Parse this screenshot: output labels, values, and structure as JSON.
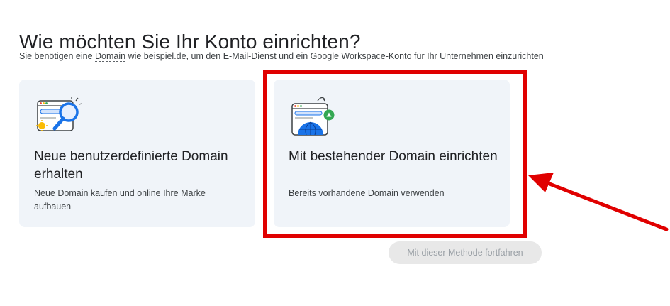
{
  "header": {
    "title": "Wie möchten Sie Ihr Konto einrichten?",
    "subtitle_prefix": "Sie benötigen eine ",
    "subtitle_link": "Domain",
    "subtitle_suffix": " wie beispiel.de, um den E-Mail-Dienst und ein Google Workspace-Konto für Ihr Unternehmen einzurichten"
  },
  "options": [
    {
      "title": "Neue benutzerdefinierte Domain erhalten",
      "description": "Neue Domain kaufen und online Ihre Marke aufbauen",
      "icon": "domain-search-icon"
    },
    {
      "title": "Mit bestehender Domain einrichten",
      "description": "Bereits vorhandene Domain verwenden",
      "icon": "existing-domain-globe-icon"
    }
  ],
  "actions": {
    "continue_label": "Mit dieser Methode fortfahren",
    "continue_enabled": false
  },
  "annotations": {
    "highlight_color": "#e00000",
    "arrow_icon": "red-arrow-icon"
  },
  "colors": {
    "card_bg": "#f0f4f9",
    "accent_blue": "#1a73e8",
    "accent_green": "#34a853",
    "accent_yellow": "#fbbc04"
  }
}
